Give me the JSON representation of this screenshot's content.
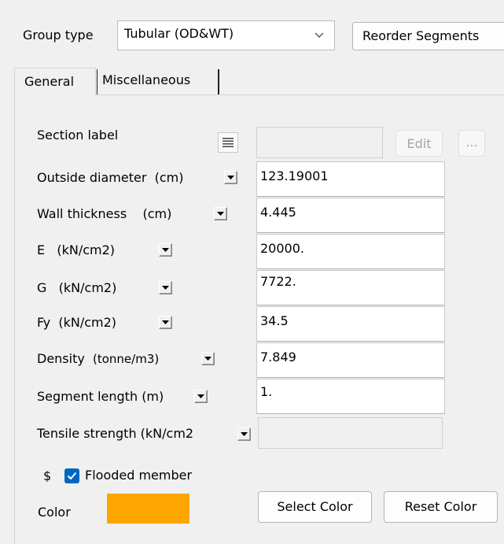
{
  "group_type": {
    "label": "Group type",
    "value": "Tubular (OD&WT)"
  },
  "reorder_button": "Reorder Segments",
  "tabs": [
    {
      "label": "General",
      "active": true
    },
    {
      "label": "Miscellaneous",
      "active": false
    }
  ],
  "section_label": {
    "label": "Section label",
    "value": "",
    "edit_button": "Edit",
    "more_button": "..."
  },
  "fields": {
    "outside_diameter": {
      "label": "Outside diameter",
      "unit": "(cm)",
      "value": "123.19001"
    },
    "wall_thickness": {
      "label": "Wall thickness",
      "unit": "(cm)",
      "value": "4.445"
    },
    "e": {
      "label": "E",
      "unit": "(kN/cm2)",
      "value": "20000."
    },
    "g": {
      "label": "G",
      "unit": "(kN/cm2)",
      "value": "7722."
    },
    "fy": {
      "label": "Fy",
      "unit": "(kN/cm2)",
      "value": "34.5"
    },
    "density": {
      "label": "Density",
      "unit": "(tonne/m3)",
      "value": "7.849"
    },
    "segment_length": {
      "label": "Segment length",
      "unit": "(m)",
      "value": "1."
    },
    "tensile_strength": {
      "label": "Tensile strength (kN/cm2",
      "value": ""
    }
  },
  "flooded": {
    "prefix": "$",
    "label": "Flooded member",
    "checked": true
  },
  "color": {
    "label": "Color",
    "swatch": "#ffa500",
    "select_button": "Select Color",
    "reset_button": "Reset Color"
  },
  "colors": {
    "accent": "#0067c0",
    "panel": "#f0f0f0"
  }
}
